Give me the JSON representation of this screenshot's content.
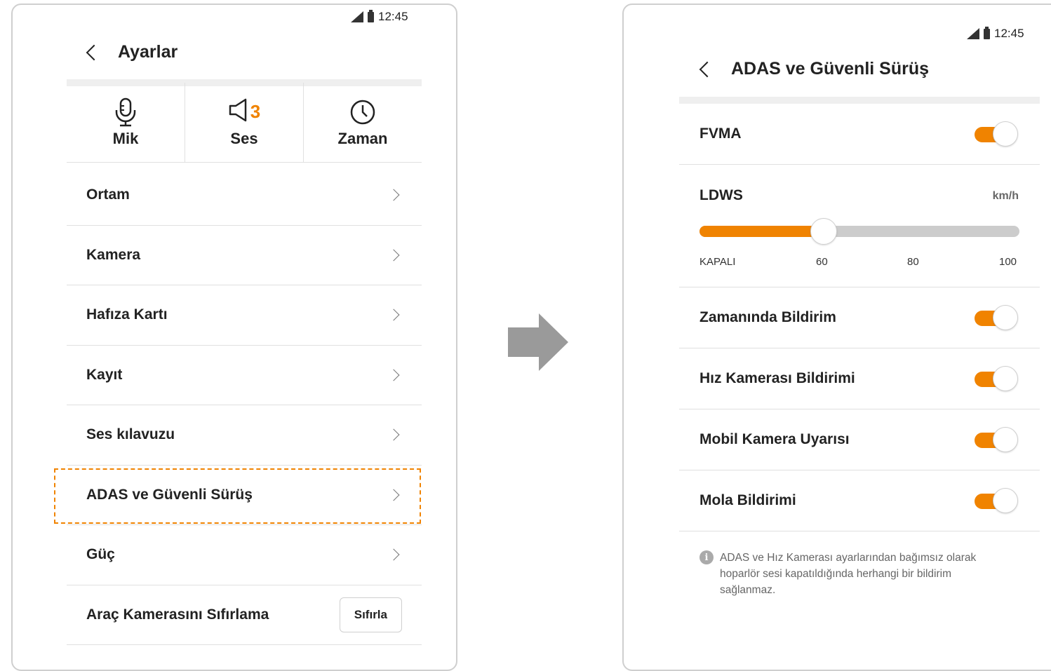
{
  "left_screen": {
    "status": {
      "time": "12:45"
    },
    "header": {
      "title": "Ayarlar"
    },
    "quick": [
      {
        "label": "Mik",
        "icon": "microphone-icon"
      },
      {
        "label": "Ses",
        "icon": "speaker-icon",
        "badge": "3"
      },
      {
        "label": "Zaman",
        "icon": "clock-icon"
      }
    ],
    "menu": [
      "Ortam",
      "Kamera",
      "Hafıza Kartı",
      "Kayıt",
      "Ses kılavuzu",
      "ADAS ve Güvenli Sürüş",
      "Güç"
    ],
    "reset": {
      "label": "Araç Kamerasını Sıfırlama",
      "button": "Sıfırla"
    }
  },
  "arrow_icon": "right-arrow-icon",
  "right_screen": {
    "status": {
      "time": "12:45"
    },
    "header": {
      "title": "ADAS ve Güvenli Sürüş"
    },
    "fvma": {
      "label": "FVMA",
      "on": true
    },
    "ldws": {
      "label": "LDWS",
      "unit": "km/h",
      "ticks": [
        "KAPALI",
        "60",
        "80",
        "100"
      ],
      "value": "60",
      "fraction": 0.385
    },
    "toggles": [
      {
        "label": "Zamanında Bildirim",
        "on": true
      },
      {
        "label": "Hız Kamerası Bildirimi",
        "on": true
      },
      {
        "label": "Mobil Kamera Uyarısı",
        "on": true
      },
      {
        "label": "Mola Bildirimi",
        "on": true
      }
    ],
    "note": "ADAS ve Hız Kamerası ayarlarından bağımsız olarak hoparlör sesi kapatıldığında herhangi bir bildirim sağlanmaz."
  },
  "colors": {
    "accent": "#f08300",
    "divider": "#e0e0e0",
    "track_off": "#cccccc",
    "frame": "#cfcfcf"
  }
}
